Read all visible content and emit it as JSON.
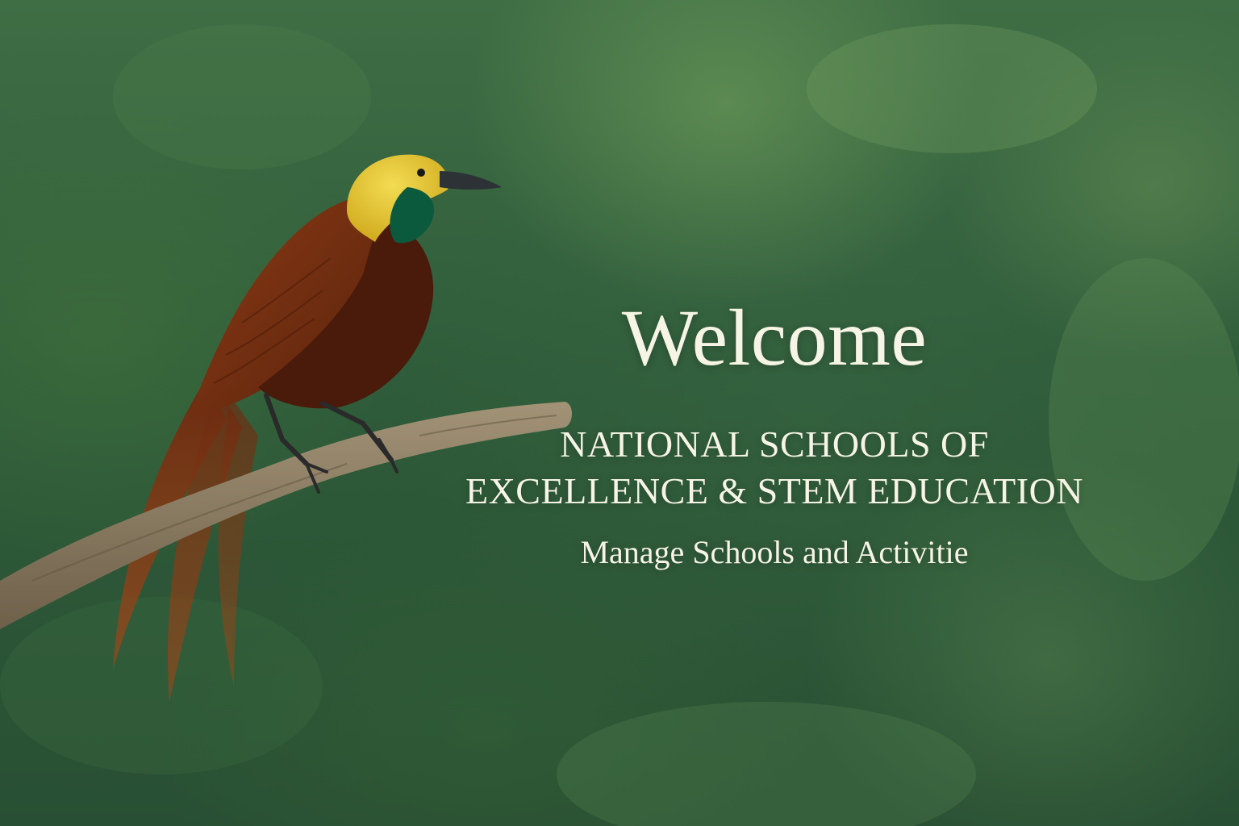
{
  "hero": {
    "welcome": "Welcome",
    "org_line1": "NATIONAL SCHOOLS OF",
    "org_line2": "EXCELLENCE & STEM EDUCATION",
    "tagline": "Manage Schools and Activitie"
  },
  "colors": {
    "text": "#f6f4e4",
    "background_green": "#2f5c3a",
    "bird_head": "#e6c72e",
    "bird_throat": "#0c5a3e",
    "bird_body": "#6b2c10",
    "branch": "#8a7a60"
  },
  "illustration": {
    "subject": "bird-of-paradise-perched-on-branch"
  }
}
